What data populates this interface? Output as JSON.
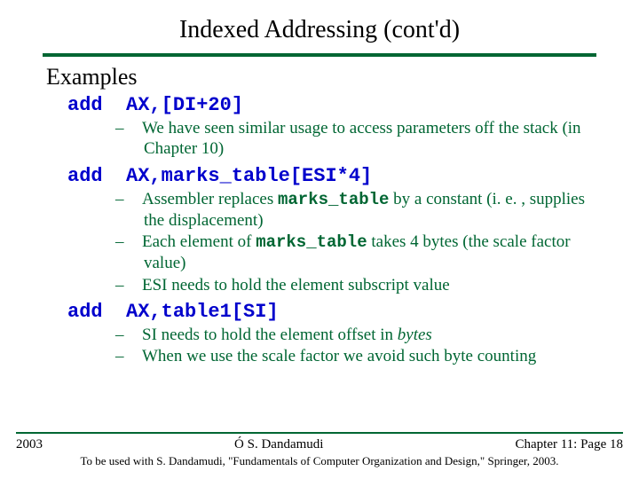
{
  "title": "Indexed Addressing (cont'd)",
  "section": "Examples",
  "examples": [
    {
      "op": "add",
      "args": "AX,[DI+20]",
      "notes": [
        {
          "pre": "We have seen similar usage to access parameters off the stack (in Chapter 10)"
        }
      ]
    },
    {
      "op": "add",
      "args": "AX,marks_table[ESI*4]",
      "notes": [
        {
          "pre": "Assembler replaces ",
          "code": "marks_table",
          "post": " by a constant (i. e. , supplies the displacement)"
        },
        {
          "pre": "Each element of ",
          "code": "marks_table",
          "post": " takes 4 bytes (the scale factor value)"
        },
        {
          "pre": "ESI needs to hold the element subscript value"
        }
      ]
    },
    {
      "op": "add",
      "args": "AX,table1[SI]",
      "notes": [
        {
          "pre": "SI needs to hold the element offset in ",
          "ital": "bytes"
        },
        {
          "pre": "When we use the scale factor we avoid such byte counting"
        }
      ]
    }
  ],
  "footer": {
    "year": "2003",
    "center": "Ó S. Dandamudi",
    "right": "Chapter 11: Page 18",
    "citation": "To be used with S. Dandamudi, \"Fundamentals of Computer Organization and Design,\" Springer, 2003."
  }
}
